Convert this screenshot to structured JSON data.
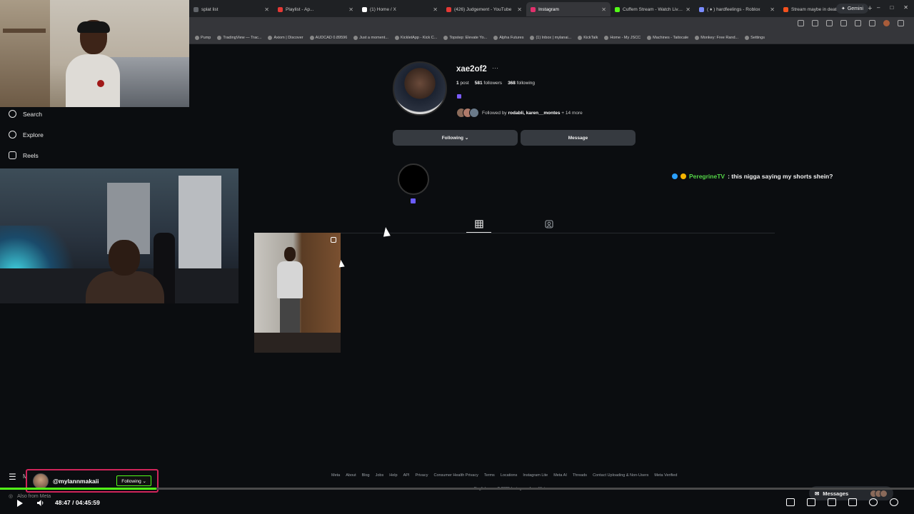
{
  "browser": {
    "tabs": [
      {
        "label": "splat list",
        "color": "#5f6368",
        "active": false
      },
      {
        "label": "Playlist - Ap...",
        "color": "#e53935",
        "active": false
      },
      {
        "label": "(1) Home / X",
        "color": "#ffffff",
        "active": false
      },
      {
        "label": "(426) Judgement - YouTube",
        "color": "#e53935",
        "active": false
      },
      {
        "label": "Instagram",
        "color": "#e1306c",
        "active": true
      },
      {
        "label": "Cuffem Stream - Watch Live on",
        "color": "#53fc18",
        "active": false
      },
      {
        "label": "( ♦ ) hardfeelings - Roblox",
        "color": "#7a8cff",
        "active": false
      },
      {
        "label": "Stream maybe in death by Obi...",
        "color": "#f4511e",
        "active": false
      }
    ],
    "new_tab": "+",
    "gemini": "Gemini",
    "window_controls": [
      "–",
      "□",
      "✕"
    ],
    "bookmarks": [
      "Pump",
      "TradingView — Trac...",
      "Axiom | Discover",
      "AUDCAD 0.89596",
      "Just a moment...",
      "KickletApp - Kick C...",
      "Topstep: Elevate Yo...",
      "Alpha Futures",
      "(1) Inbox | mylanai...",
      "KickTalk",
      "Home - My JSCC",
      "Machines - Taitocale",
      "Monkey: Free Rand...",
      "Settings"
    ]
  },
  "sidebar": {
    "items": [
      {
        "label": "Search",
        "icon": "search-icon"
      },
      {
        "label": "Explore",
        "icon": "compass-icon"
      },
      {
        "label": "Reels",
        "icon": "reels-icon"
      }
    ],
    "menu_short": "M",
    "also_from": "Also from Meta"
  },
  "profile": {
    "username": "xae2of2",
    "more": "···",
    "stats": {
      "posts": "1",
      "posts_label": "post",
      "followers": "581",
      "followers_label": "followers",
      "following": "368",
      "following_label": "following"
    },
    "bio": "",
    "followed_by_prefix": "Followed by ",
    "followed_by_names": "rodabli, karen__montes",
    "followed_by_suffix": " + 14 more",
    "following_button": "Following ⌄",
    "message_button": "Message"
  },
  "chat": {
    "username": "PeregrineTV",
    "message": ": this nigga saying my shorts shein?"
  },
  "footer": {
    "links": [
      "Meta",
      "About",
      "Blog",
      "Jobs",
      "Help",
      "API",
      "Privacy",
      "Consumer Health Privacy",
      "Terms",
      "Locations",
      "Instagram Lite",
      "Meta AI",
      "Threads",
      "Contact Uploading & Non-Users",
      "Meta Verified"
    ],
    "language": "English ⌄",
    "copyright": "© 2025 Instagram from Meta"
  },
  "messages": {
    "label": "Messages"
  },
  "follow_overlay": {
    "handle": "@mylannmakaii",
    "button": "Following ⌄"
  },
  "player": {
    "current_time": "48:47",
    "separator": " / ",
    "total_time": "04:45:59",
    "progress": 0.171,
    "accent": "#53fc18"
  }
}
